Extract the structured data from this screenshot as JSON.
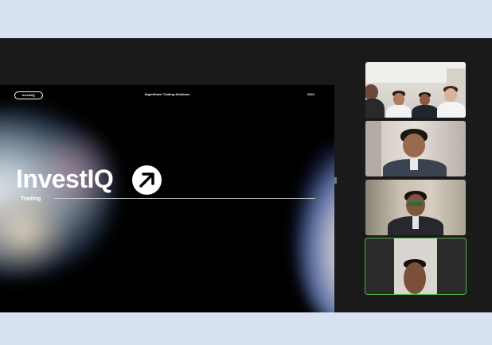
{
  "slide": {
    "brand_pill": "InvestIQ",
    "header": "Algorithmic Trading Solutions",
    "year": "2024",
    "logo_text": "InvestIQ",
    "logo_icon": "arrow-up-right-icon",
    "subtitle": "Trading"
  },
  "participants": [
    {
      "tile": "participant-tile-group",
      "icon": "video-feed"
    },
    {
      "tile": "participant-tile-2",
      "icon": "video-feed"
    },
    {
      "tile": "participant-tile-3",
      "icon": "video-feed"
    },
    {
      "tile": "participant-tile-4",
      "icon": "video-feed",
      "speaking": true
    }
  ],
  "colors": {
    "active_speaker_border": "#4fb34a",
    "frame_background": "#d6e2f1",
    "call_background": "#1a1a1a"
  }
}
